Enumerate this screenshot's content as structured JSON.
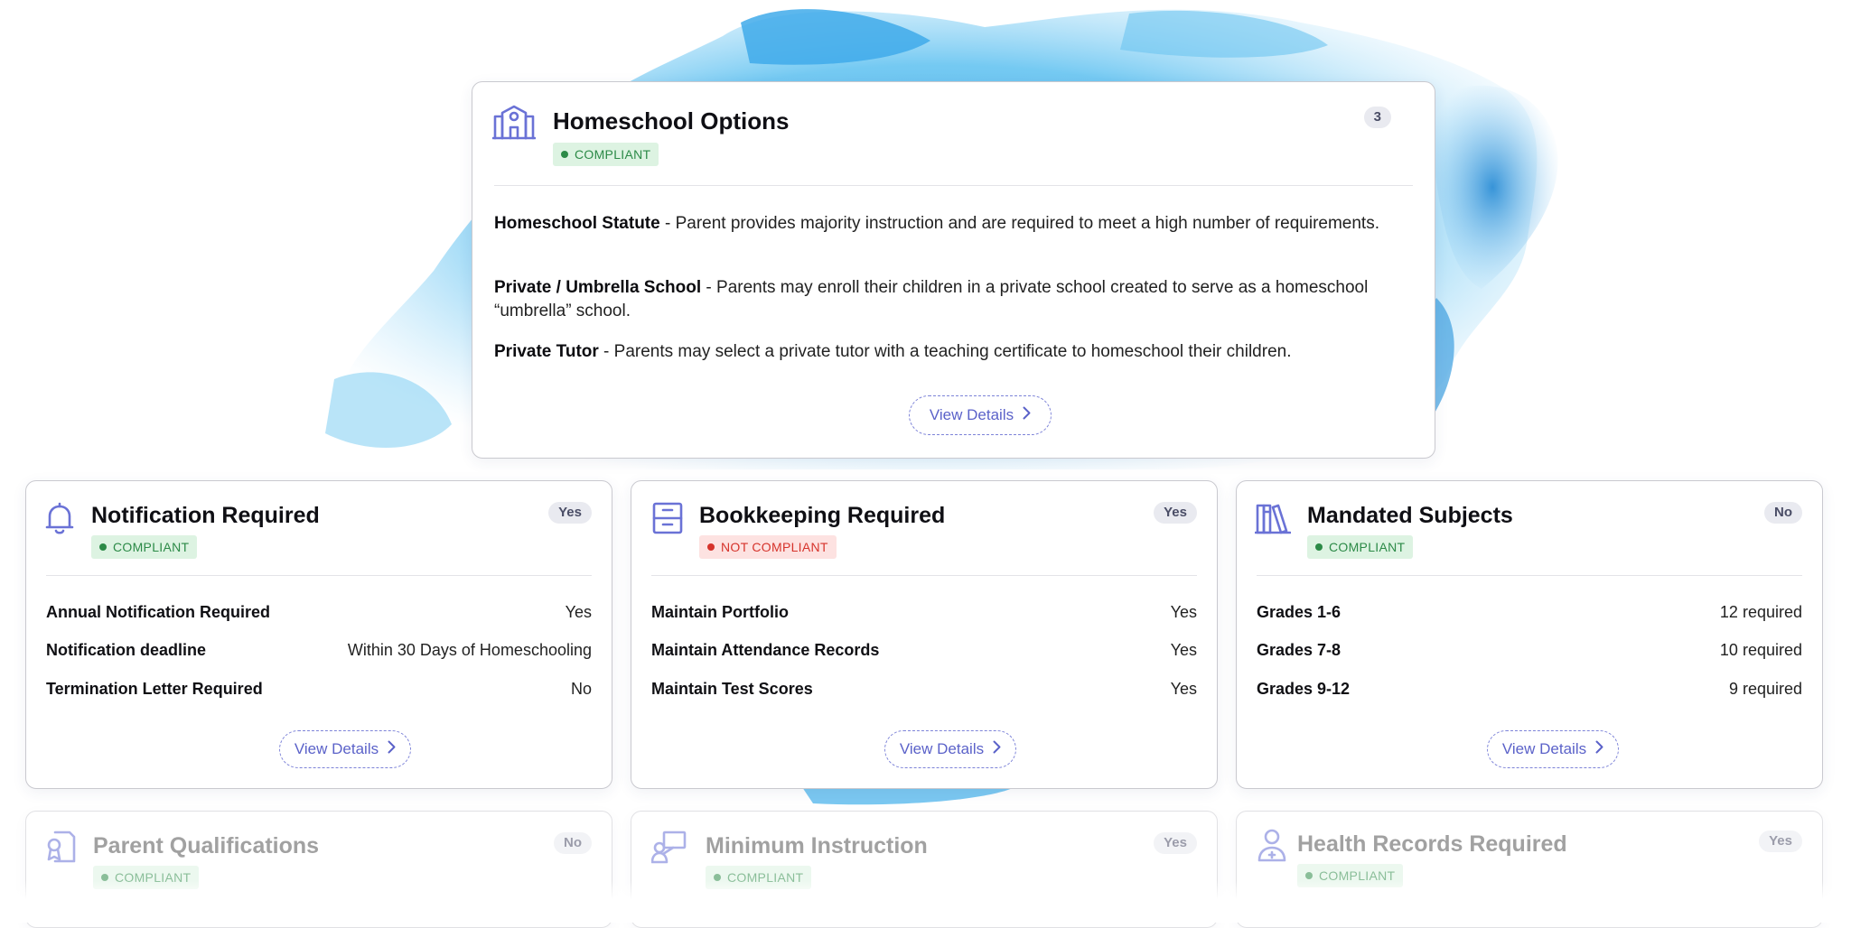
{
  "colors": {
    "accent": "#5b62c9",
    "compliant": "#2c8a47",
    "not_compliant": "#d6332b",
    "splash": "#4fb6ec"
  },
  "homeschool_options": {
    "icon": "school-building-icon",
    "title": "Homeschool Options",
    "status": "COMPLIANT",
    "count": "3",
    "options": [
      {
        "name": "Homeschool Statute",
        "description": " - Parent provides majority instruction and are required to meet a high number of requirements."
      },
      {
        "name": "Private / Umbrella School",
        "description": " - Parents may enroll their children in a private school created to serve as a homeschool “umbrella” school."
      },
      {
        "name": "Private Tutor",
        "description": " - Parents may select a private tutor with a teaching certificate to homeschool their children."
      }
    ],
    "view_details": "View Details"
  },
  "cards": [
    {
      "icon": "bell-icon",
      "title": "Notification Required",
      "status": "COMPLIANT",
      "count": "Yes",
      "rows": [
        {
          "label": "Annual Notification Required",
          "value": "Yes"
        },
        {
          "label": "Notification deadline",
          "value": "Within 30 Days of Homeschooling"
        },
        {
          "label": "Termination Letter Required",
          "value": "No"
        }
      ],
      "view_details": "View Details"
    },
    {
      "icon": "file-cabinet-icon",
      "title": "Bookkeeping Required",
      "status": "NOT COMPLIANT",
      "count": "Yes",
      "rows": [
        {
          "label": "Maintain Portfolio",
          "value": "Yes"
        },
        {
          "label": "Maintain Attendance Records",
          "value": "Yes"
        },
        {
          "label": "Maintain Test Scores",
          "value": "Yes"
        }
      ],
      "view_details": "View Details"
    },
    {
      "icon": "books-icon",
      "title": "Mandated Subjects",
      "status": "COMPLIANT",
      "count": "No",
      "rows": [
        {
          "label": "Grades 1-6",
          "value": "12 required"
        },
        {
          "label": "Grades 7-8",
          "value": "10 required"
        },
        {
          "label": "Grades 9-12",
          "value": "9 required"
        }
      ],
      "view_details": "View Details"
    }
  ],
  "partial_cards": [
    {
      "icon": "certificate-icon",
      "title": "Parent Qualifications",
      "status": "COMPLIANT",
      "count": "No"
    },
    {
      "icon": "teacher-board-icon",
      "title": "Minimum Instruction",
      "status": "COMPLIANT",
      "count": "Yes"
    },
    {
      "icon": "medical-person-icon",
      "title": "Health Records Required",
      "status": "COMPLIANT",
      "count": "Yes"
    }
  ]
}
